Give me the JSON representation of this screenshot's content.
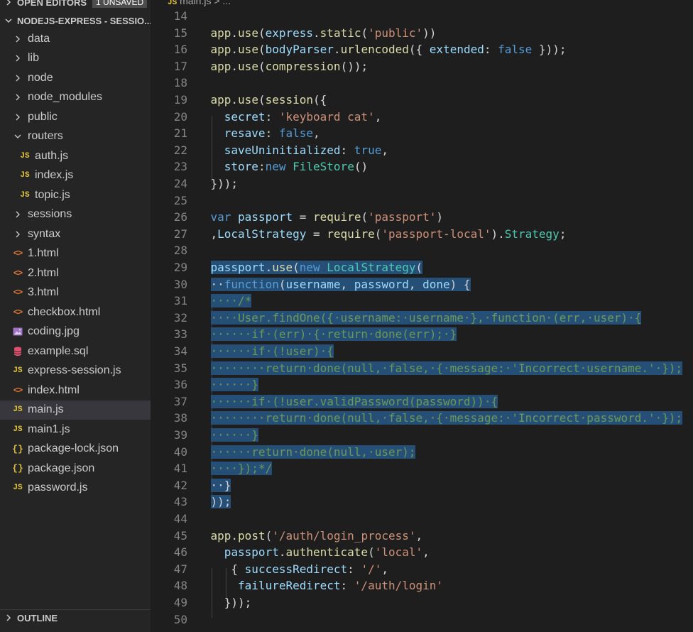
{
  "sidebar": {
    "open_editors": {
      "title": "OPEN EDITORS",
      "badge": "1 UNSAVED"
    },
    "folder": {
      "title": "NODEJS-EXPRESS - SESSIO..."
    },
    "items": [
      {
        "label": "data",
        "kind": "folder"
      },
      {
        "label": "lib",
        "kind": "folder"
      },
      {
        "label": "node",
        "kind": "folder"
      },
      {
        "label": "node_modules",
        "kind": "folder"
      },
      {
        "label": "public",
        "kind": "folder"
      },
      {
        "label": "routers",
        "kind": "folder-open"
      },
      {
        "label": "auth.js",
        "kind": "js",
        "indent": 1
      },
      {
        "label": "index.js",
        "kind": "js",
        "indent": 1
      },
      {
        "label": "topic.js",
        "kind": "js",
        "indent": 1
      },
      {
        "label": "sessions",
        "kind": "folder"
      },
      {
        "label": "syntax",
        "kind": "folder"
      },
      {
        "label": "1.html",
        "kind": "html"
      },
      {
        "label": "2.html",
        "kind": "html"
      },
      {
        "label": "3.html",
        "kind": "html"
      },
      {
        "label": "checkbox.html",
        "kind": "html"
      },
      {
        "label": "coding.jpg",
        "kind": "image"
      },
      {
        "label": "example.sql",
        "kind": "db"
      },
      {
        "label": "express-session.js",
        "kind": "js"
      },
      {
        "label": "index.html",
        "kind": "html"
      },
      {
        "label": "main.js",
        "kind": "js",
        "active": true
      },
      {
        "label": "main1.js",
        "kind": "js"
      },
      {
        "label": "package-lock.json",
        "kind": "json"
      },
      {
        "label": "package.json",
        "kind": "json"
      },
      {
        "label": "password.js",
        "kind": "js"
      }
    ],
    "outline": {
      "title": "OUTLINE"
    },
    "file_icon_labels": {
      "js": "JS",
      "html": "<>",
      "json": "{}"
    }
  },
  "breadcrumb": {
    "file": "main.js",
    "sep": " > ..."
  },
  "editor": {
    "lines": [
      {
        "n": "14",
        "t": []
      },
      {
        "n": "15",
        "t": [
          [
            "app",
            "fn"
          ],
          [
            ".",
            "pun"
          ],
          [
            "use",
            "fn"
          ],
          [
            "(",
            "pun"
          ],
          [
            "express",
            "var"
          ],
          [
            ".",
            "pun"
          ],
          [
            "static",
            "fn"
          ],
          [
            "(",
            "pun"
          ],
          [
            "'public'",
            "str"
          ],
          [
            "))",
            "pun"
          ]
        ]
      },
      {
        "n": "16",
        "t": [
          [
            "app",
            "fn"
          ],
          [
            ".",
            "pun"
          ],
          [
            "use",
            "fn"
          ],
          [
            "(",
            "pun"
          ],
          [
            "bodyParser",
            "var"
          ],
          [
            ".",
            "pun"
          ],
          [
            "urlencoded",
            "fn"
          ],
          [
            "({ ",
            "pun"
          ],
          [
            "extended",
            "var"
          ],
          [
            ": ",
            "pun"
          ],
          [
            "false",
            "kw"
          ],
          [
            " }));",
            "pun"
          ]
        ]
      },
      {
        "n": "17",
        "t": [
          [
            "app",
            "fn"
          ],
          [
            ".",
            "pun"
          ],
          [
            "use",
            "fn"
          ],
          [
            "(",
            "pun"
          ],
          [
            "compression",
            "fn"
          ],
          [
            "());",
            "pun"
          ]
        ]
      },
      {
        "n": "18",
        "t": []
      },
      {
        "n": "19",
        "t": [
          [
            "app",
            "fn"
          ],
          [
            ".",
            "pun"
          ],
          [
            "use",
            "fn"
          ],
          [
            "(",
            "pun"
          ],
          [
            "session",
            "fn"
          ],
          [
            "({",
            "pun"
          ]
        ]
      },
      {
        "n": "20",
        "t": [
          [
            "  ",
            "pun"
          ],
          [
            "secret",
            "var"
          ],
          [
            ": ",
            "pun"
          ],
          [
            "'keyboard cat'",
            "str"
          ],
          [
            ",",
            "pun"
          ]
        ]
      },
      {
        "n": "21",
        "t": [
          [
            "  ",
            "pun"
          ],
          [
            "resave",
            "var"
          ],
          [
            ": ",
            "pun"
          ],
          [
            "false",
            "kw"
          ],
          [
            ",",
            "pun"
          ]
        ]
      },
      {
        "n": "22",
        "t": [
          [
            "  ",
            "pun"
          ],
          [
            "saveUninitialized",
            "var"
          ],
          [
            ": ",
            "pun"
          ],
          [
            "true",
            "kw"
          ],
          [
            ",",
            "pun"
          ]
        ]
      },
      {
        "n": "23",
        "t": [
          [
            "  ",
            "pun"
          ],
          [
            "store",
            "var"
          ],
          [
            ":",
            "pun"
          ],
          [
            "new",
            "kw"
          ],
          [
            " ",
            "pun"
          ],
          [
            "FileStore",
            "cls"
          ],
          [
            "()",
            "pun"
          ]
        ]
      },
      {
        "n": "24",
        "t": [
          [
            "}));",
            "pun"
          ]
        ]
      },
      {
        "n": "25",
        "t": []
      },
      {
        "n": "26",
        "t": [
          [
            "var",
            "kw"
          ],
          [
            " ",
            "pun"
          ],
          [
            "passport",
            "var"
          ],
          [
            " = ",
            "pun"
          ],
          [
            "require",
            "fn"
          ],
          [
            "(",
            "pun"
          ],
          [
            "'passport'",
            "str"
          ],
          [
            ")",
            "pun"
          ]
        ]
      },
      {
        "n": "27",
        "t": [
          [
            ",",
            "pun"
          ],
          [
            "LocalStrategy",
            "var"
          ],
          [
            " = ",
            "pun"
          ],
          [
            "require",
            "fn"
          ],
          [
            "(",
            "pun"
          ],
          [
            "'passport-local'",
            "str"
          ],
          [
            ").",
            "pun"
          ],
          [
            "Strategy",
            "cls"
          ],
          [
            ";",
            "pun"
          ]
        ]
      },
      {
        "n": "28",
        "t": []
      },
      {
        "n": "29",
        "sel": true,
        "t": [
          [
            "passport",
            "var"
          ],
          [
            ".",
            "pun"
          ],
          [
            "use",
            "fn"
          ],
          [
            "(",
            "pun"
          ],
          [
            "new",
            "kw"
          ],
          [
            " ",
            "pun"
          ],
          [
            "LocalStrategy",
            "cls"
          ],
          [
            "(",
            "pun"
          ]
        ]
      },
      {
        "n": "30",
        "sel": true,
        "t": [
          [
            "··",
            "pun"
          ],
          [
            "function",
            "kw"
          ],
          [
            "(",
            "pun"
          ],
          [
            "username",
            "var"
          ],
          [
            ", ",
            "pun"
          ],
          [
            "password",
            "var"
          ],
          [
            ", ",
            "pun"
          ],
          [
            "done",
            "var"
          ],
          [
            ") {",
            "pun"
          ]
        ]
      },
      {
        "n": "31",
        "sel": true,
        "t": [
          [
            "····/*",
            "cm"
          ]
        ]
      },
      {
        "n": "32",
        "sel": true,
        "t": [
          [
            "····User.findOne({·username:·username·},·function·(err,·user)·{",
            "cm"
          ]
        ]
      },
      {
        "n": "33",
        "sel": true,
        "t": [
          [
            "······if·(err)·{·return·done(err);·}",
            "cm"
          ]
        ]
      },
      {
        "n": "34",
        "sel": true,
        "t": [
          [
            "······if·(!user)·{",
            "cm"
          ]
        ]
      },
      {
        "n": "35",
        "sel": true,
        "t": [
          [
            "········return·done(null,·false,·{·message:·'Incorrect·username.'·});",
            "cm"
          ]
        ]
      },
      {
        "n": "36",
        "sel": true,
        "t": [
          [
            "······}",
            "cm"
          ]
        ]
      },
      {
        "n": "37",
        "sel": true,
        "t": [
          [
            "······if·(!user.validPassword(password))·{",
            "cm"
          ]
        ]
      },
      {
        "n": "38",
        "sel": true,
        "t": [
          [
            "········return·done(null,·false,·{·message:·'Incorrect·password.'·});",
            "cm"
          ]
        ]
      },
      {
        "n": "39",
        "sel": true,
        "t": [
          [
            "······}",
            "cm"
          ]
        ]
      },
      {
        "n": "40",
        "sel": true,
        "t": [
          [
            "······return·done(null,·user);",
            "cm"
          ]
        ]
      },
      {
        "n": "41",
        "sel": true,
        "t": [
          [
            "····});*/",
            "cm"
          ]
        ]
      },
      {
        "n": "42",
        "sel": true,
        "t": [
          [
            "··}",
            "pun"
          ]
        ]
      },
      {
        "n": "43",
        "sel": true,
        "t": [
          [
            "));",
            "pun"
          ]
        ]
      },
      {
        "n": "44",
        "t": []
      },
      {
        "n": "45",
        "t": [
          [
            "app",
            "fn"
          ],
          [
            ".",
            "pun"
          ],
          [
            "post",
            "fn"
          ],
          [
            "(",
            "pun"
          ],
          [
            "'/auth/login_process'",
            "str"
          ],
          [
            ",",
            "pun"
          ]
        ]
      },
      {
        "n": "46",
        "t": [
          [
            "  ",
            "pun"
          ],
          [
            "passport",
            "var"
          ],
          [
            ".",
            "pun"
          ],
          [
            "authenticate",
            "fn"
          ],
          [
            "(",
            "pun"
          ],
          [
            "'local'",
            "str"
          ],
          [
            ",",
            "pun"
          ]
        ]
      },
      {
        "n": "47",
        "t": [
          [
            "   { ",
            "pun"
          ],
          [
            "successRedirect",
            "var"
          ],
          [
            ": ",
            "pun"
          ],
          [
            "'/'",
            "str"
          ],
          [
            ",",
            "pun"
          ]
        ]
      },
      {
        "n": "48",
        "t": [
          [
            "    ",
            "pun"
          ],
          [
            "failureRedirect",
            "var"
          ],
          [
            ": ",
            "pun"
          ],
          [
            "'/auth/login'",
            "str"
          ]
        ]
      },
      {
        "n": "49",
        "t": [
          [
            "  }));",
            "pun"
          ]
        ]
      },
      {
        "n": "50",
        "t": []
      }
    ]
  },
  "colors": {
    "editor_bg": "#1e1e1e",
    "sidebar_bg": "#252526",
    "selection": "#264f78",
    "keyword": "#569cd6",
    "function": "#dcdcaa",
    "variable": "#9cdcfe",
    "string": "#ce9178",
    "class": "#4ec9b0",
    "comment": "#6a9955"
  },
  "icons": {
    "folder_collapsed": "chevron-right-icon",
    "folder_expanded": "chevron-down-icon",
    "image_file": "image-icon",
    "sql_file": "database-icon"
  }
}
